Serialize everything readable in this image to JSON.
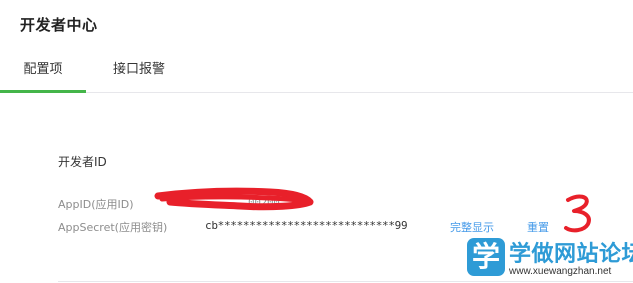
{
  "header": {
    "title": "开发者中心"
  },
  "tabs": [
    {
      "label": "配置项",
      "active": true
    },
    {
      "label": "接口报警",
      "active": false
    }
  ],
  "developer_id": {
    "section_title": "开发者ID",
    "app_id": {
      "label": "AppID(应用ID)",
      "value": "00200"
    },
    "app_secret": {
      "label": "AppSecret(应用密钥)",
      "value": "cb****************************99",
      "show_full_label": "完整显示",
      "reset_label": "重置"
    }
  },
  "watermark": {
    "badge": "学",
    "name": "学做网站论坛",
    "url": "www.xuewangzhan.net"
  },
  "colors": {
    "accent_green": "#44b549",
    "link_blue": "#459ae9",
    "watermark_blue": "#2e9bd6",
    "scribble_red": "#e8202a"
  }
}
